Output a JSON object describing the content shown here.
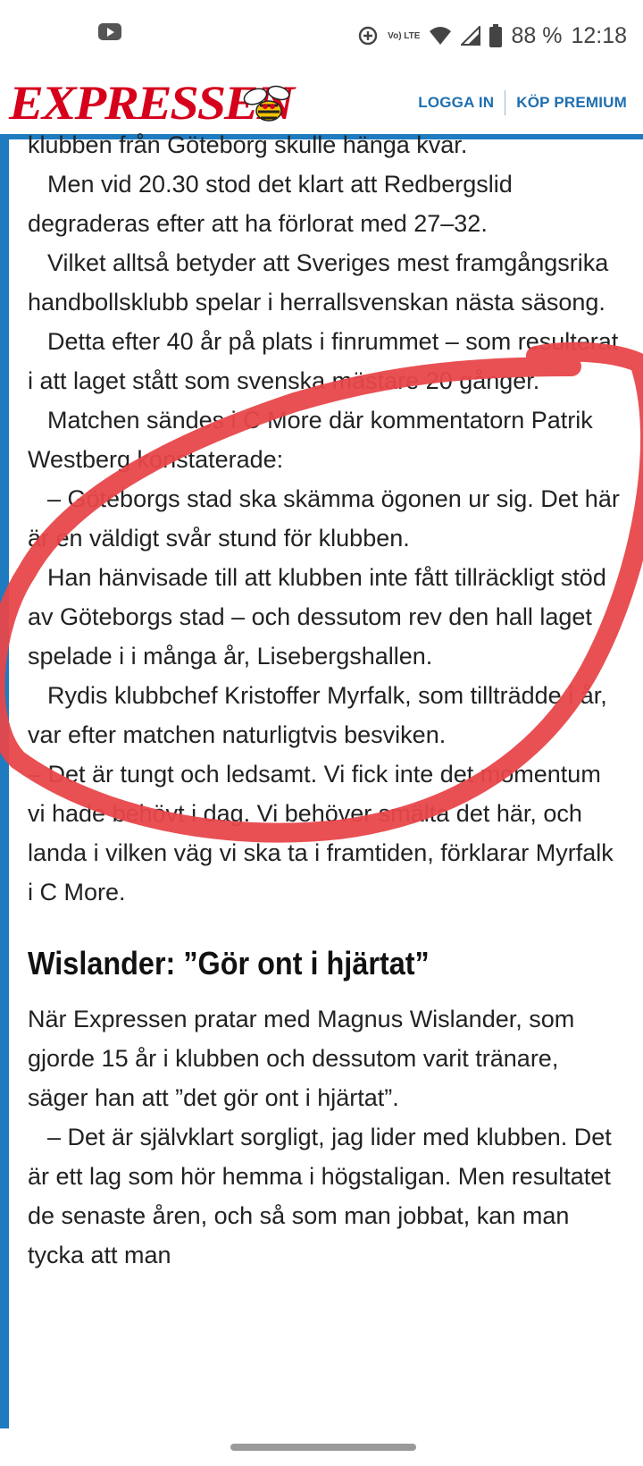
{
  "status_bar": {
    "volte_label": "Vo) LTE",
    "battery": "88 %",
    "time": "12:18"
  },
  "header": {
    "logo": "EXPRESSEN",
    "login": "LOGGA IN",
    "premium": "KÖP PREMIUM"
  },
  "article": {
    "paragraphs": [
      "klubben från Göteborg skulle hänga kvar.",
      "Men vid 20.30 stod det klart att Redbergslid degraderas efter att ha förlorat med 27–32.",
      "Vilket alltså betyder att Sveriges mest framgångsrika handbollsklubb spelar i herrallsvenskan nästa säsong.",
      "Detta efter 40 år på plats i finrummet – som resulterat i att laget stått som svenska mästare 20 gånger.",
      "Matchen sändes i C More där kommentatorn Patrik Westberg konstaterade:",
      "– Göteborgs stad ska skämma ögonen ur sig. Det här är en väldigt svår stund för klubben.",
      "Han hänvisade till att klubben inte fått tillräckligt stöd av Göteborgs stad – och dessutom rev den hall laget spelade i i många år, Lisebergshallen.",
      "Rydis klubbchef Kristoffer Myrfalk, som tillträdde i år, var efter matchen naturligtvis besviken.",
      "– Det är tungt och ledsamt. Vi fick inte det momentum vi hade behövt i dag. Vi behöver smälta det här, och landa i vilken väg vi ska ta i framtiden, förklarar Myrfalk i C More."
    ],
    "subheading": "Wislander: ”Gör ont i hjärtat”",
    "paragraphs2": [
      "När Expressen pratar med Magnus Wislander, som gjorde 15 år i klubben och dessutom varit tränare, säger han att ”det gör ont i hjärtat”.",
      "– Det är självklart sorgligt, jag lider med klubben. Det är ett lag som hör hemma i högstaligan. Men resultatet de senaste åren, och så som man jobbat, kan man tycka att man"
    ]
  },
  "colors": {
    "brand_red": "#d6001c",
    "brand_blue": "#1e7bbf",
    "scribble": "#e8474a"
  }
}
